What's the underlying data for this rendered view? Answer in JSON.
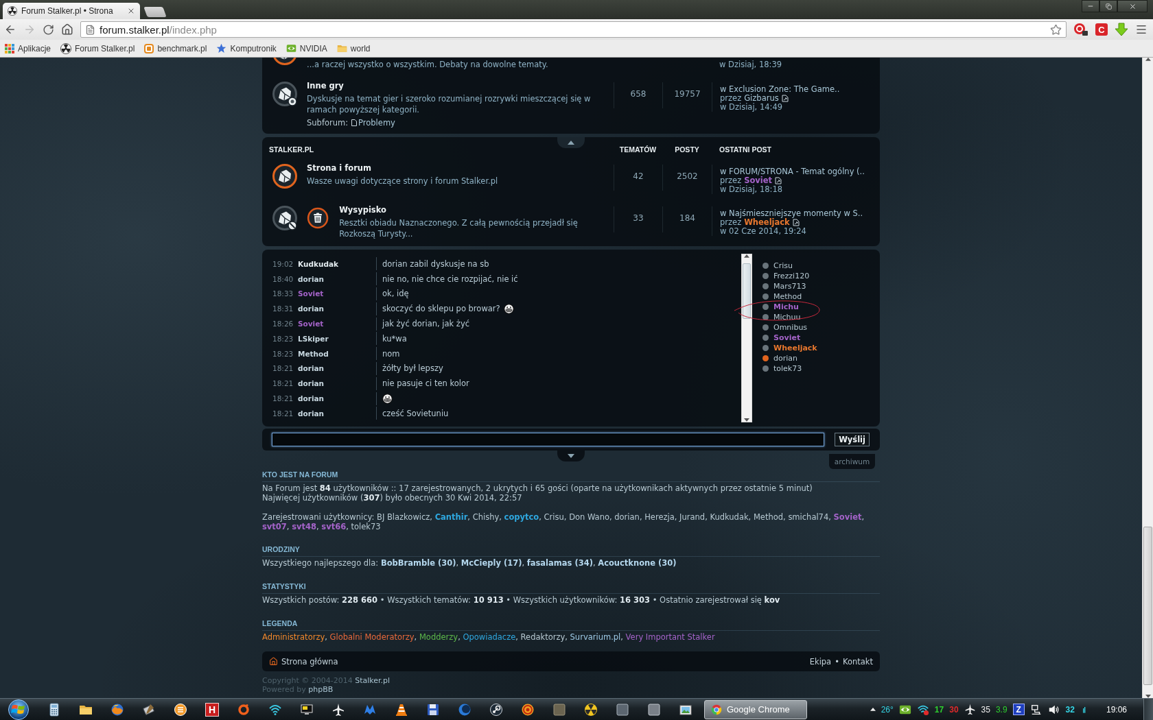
{
  "browser": {
    "tab_title": "Forum Stalker.pl • Strona",
    "url_host": "forum.stalker.pl",
    "url_path": "/index.php",
    "back_enabled": true,
    "forward_enabled": false,
    "extension_letter": "C",
    "bookmarks": [
      "Aplikacje",
      "Forum Stalker.pl",
      "benchmark.pl",
      "Komputronik",
      "NVIDIA",
      "world"
    ]
  },
  "forum_sections": [
    {
      "cut_row": {
        "unread": true,
        "description": "...a raczej wszystko o wszystkim. Debaty na dowolne tematy.",
        "last_post_time": "w Dzisiaj, 18:39"
      },
      "rows": [
        {
          "kind": "plain",
          "title": "Inne gry",
          "unread": false,
          "locked": false,
          "description": "Dyskusje na temat gier i szeroko rozumianej rozrywki mieszczącej się w ramach powyższej kategorii.",
          "subforum_label": "Subforum:",
          "subforums": [
            "Problemy"
          ],
          "topics": "658",
          "posts": "19757",
          "last_post": {
            "topic": "w Exclusion Zone: The Game..",
            "by": "przez",
            "author": {
              "name": "Gizbarus",
              "color": "#a9c8d8",
              "bold": false
            },
            "time": "w Dzisiaj, 14:49"
          }
        }
      ]
    },
    {
      "header": {
        "title": "STALKER.PL",
        "topics": "TEMATÓW",
        "posts": "POSTY",
        "last_post": "OSTATNI POST"
      },
      "rows": [
        {
          "kind": "plain",
          "title": "Strona i forum",
          "unread": true,
          "locked": false,
          "description": "Wasze uwagi dotyczące strony i forum Stalker.pl",
          "topics": "42",
          "posts": "2502",
          "last_post": {
            "topic": "w FORUM/STRONA - Temat ogólny (..",
            "by": "przez",
            "author": {
              "name": "Soviet",
              "color": "#a463c9",
              "bold": true
            },
            "time": "w Dzisiaj, 18:18"
          }
        },
        {
          "kind": "image",
          "title": "Wysypisko",
          "unread": false,
          "locked": true,
          "description": "Resztki obiadu Naznaczonego. Z całą pewnością przejadł się Rozkoszą Turysty...",
          "topics": "33",
          "posts": "184",
          "last_post": {
            "topic": "w Najśmieszniejszye momenty w S..",
            "by": "przez",
            "author": {
              "name": "Wheeljack",
              "color": "#e8772e",
              "bold": true
            },
            "time": "w 02 Cze 2014, 19:24"
          }
        }
      ]
    }
  ],
  "chat": {
    "messages": [
      {
        "time": "19:02",
        "author": "Kudkudak",
        "color": "#e4ecf0",
        "text": "dorian zabil dyskusje na sb",
        "emoticon": false
      },
      {
        "time": "18:40",
        "author": "dorian",
        "color": "#c9d9e2",
        "text": "nie no, nie chce cie rozpijać, nie ić",
        "emoticon": false
      },
      {
        "time": "18:33",
        "author": "Soviet",
        "color": "#a463c9",
        "text": "ok, idę",
        "emoticon": false
      },
      {
        "time": "18:31",
        "author": "dorian",
        "color": "#c9d9e2",
        "text": "skoczyć do sklepu po browar?",
        "emoticon": true
      },
      {
        "time": "18:26",
        "author": "Soviet",
        "color": "#a463c9",
        "text": "jak żyć dorian, jak żyć",
        "emoticon": false
      },
      {
        "time": "18:23",
        "author": "LSkiper",
        "color": "#c9d9e2",
        "text": "ku*wa",
        "emoticon": false
      },
      {
        "time": "18:23",
        "author": "Method",
        "color": "#c9d9e2",
        "text": "nom",
        "emoticon": false
      },
      {
        "time": "18:21",
        "author": "dorian",
        "color": "#c9d9e2",
        "text": "żółty był lepszy",
        "emoticon": false
      },
      {
        "time": "18:21",
        "author": "dorian",
        "color": "#c9d9e2",
        "text": "nie pasuje ci ten kolor",
        "emoticon": false
      },
      {
        "time": "18:21",
        "author": "dorian",
        "color": "#c9d9e2",
        "emoticon": true
      },
      {
        "time": "18:21",
        "author": "dorian",
        "color": "#c9d9e2",
        "text": "cześć Sovietuniu",
        "emoticon": false
      }
    ],
    "users": [
      {
        "name": "Crisu",
        "color": "#b7c9d2",
        "bold": false,
        "status_dot": {
          "color": "#69747b"
        }
      },
      {
        "name": "Frezzi120",
        "color": "#b7c9d2",
        "bold": false,
        "status_dot": {
          "color": "#69747b"
        }
      },
      {
        "name": "Mars713",
        "color": "#b7c9d2",
        "bold": false,
        "status_dot": {
          "color": "#69747b"
        }
      },
      {
        "name": "Method",
        "color": "#b7c9d2",
        "bold": false,
        "status_dot": {
          "color": "#69747b"
        }
      },
      {
        "name": "Michu",
        "color": "#a463c9",
        "bold": true,
        "status_dot": {
          "color": "#69747b"
        }
      },
      {
        "name": "Michuu",
        "color": "#b7c9d2",
        "bold": false,
        "status_dot": {
          "color": "#69747b"
        }
      },
      {
        "name": "Omnibus",
        "color": "#b7c9d2",
        "bold": false,
        "status_dot": {
          "color": "#69747b"
        }
      },
      {
        "name": "Soviet",
        "color": "#a463c9",
        "bold": true,
        "status_dot": {
          "color": "#69747b"
        }
      },
      {
        "name": "Wheeljack",
        "color": "#e8772e",
        "bold": true,
        "status_dot": {
          "color": "#69747b"
        }
      },
      {
        "name": "dorian",
        "color": "#b7c9d2",
        "bold": false,
        "status_dot": {
          "color": "#e0641e"
        }
      },
      {
        "name": "tolek73",
        "color": "#b7c9d2",
        "bold": false,
        "status_dot": {
          "color": "#69747b"
        }
      }
    ],
    "input_focused": true,
    "send_label": "Wyślij",
    "archive_label": "archiwum"
  },
  "who_is_online": {
    "heading": "KTO JEST NA FORUM",
    "summary": "Na Forum jest **84** użytkowników :: 17 zarejestrowanych, 2 ukrytych i 65 gości (oparte na użytkownikach aktywnych przez ostatnie 5 minut)",
    "record": "Najwięcej użytkowników (**307**) było obecnych 30 Kwi 2014, 22:57",
    "registered_label": "Zarejestrowani użytkownicy:",
    "separator": ",",
    "registered": [
      {
        "name": "BJ Blazkowicz",
        "color": "#b7c9d2",
        "bold": false
      },
      {
        "name": "Canthir",
        "color": "#2ea8e0",
        "bold": true
      },
      {
        "name": "Chishy",
        "color": "#b7c9d2",
        "bold": false
      },
      {
        "name": "copytco",
        "color": "#2ea8e0",
        "bold": true
      },
      {
        "name": "Crisu",
        "color": "#b7c9d2",
        "bold": false
      },
      {
        "name": "Don Wano",
        "color": "#b7c9d2",
        "bold": false
      },
      {
        "name": "dorian",
        "color": "#b7c9d2",
        "bold": false
      },
      {
        "name": "Herezja",
        "color": "#b7c9d2",
        "bold": false
      },
      {
        "name": "Jurand",
        "color": "#b7c9d2",
        "bold": false
      },
      {
        "name": "Kudkudak",
        "color": "#b7c9d2",
        "bold": false
      },
      {
        "name": "Method",
        "color": "#b7c9d2",
        "bold": false
      },
      {
        "name": "smichal74",
        "color": "#b7c9d2",
        "bold": false
      },
      {
        "name": "Soviet",
        "color": "#a463c9",
        "bold": true
      },
      {
        "name": "svt07",
        "color": "#a463c9",
        "bold": true
      },
      {
        "name": "svt48",
        "color": "#a463c9",
        "bold": true
      },
      {
        "name": "svt66",
        "color": "#a463c9",
        "bold": true
      },
      {
        "name": "tolek73",
        "color": "#b7c9d2",
        "bold": false
      }
    ]
  },
  "birthdays": {
    "heading": "URODZINY",
    "text": "Wszystkiego najlepszego dla: **BobBramble (30)**, **McCieply (17)**, **fasalamas (34)**, **Acouctknone (30)**"
  },
  "statistics": {
    "heading": "STATYSTYKI",
    "text": "Wszystkich postów: **228 660** • Wszystkich tematów: **10 913** • Wszystkich użytkowników: **16 303** • Ostatnio zarejestrował się **kov**"
  },
  "legend": {
    "heading": "LEGENDA",
    "separator": ",",
    "groups": [
      {
        "name": "Administratorzy",
        "color": "#f0862a"
      },
      {
        "name": "Globalni Moderatorzy",
        "color": "#e8683a"
      },
      {
        "name": "Modderzy",
        "color": "#5cb84a"
      },
      {
        "name": "Opowiadacze",
        "color": "#2ea8e0"
      },
      {
        "name": "Redaktorzy",
        "color": "#b7c9d2"
      },
      {
        "name": "Survarium.pl",
        "color": "#9ecae6"
      },
      {
        "name": "Very Important Stalker",
        "color": "#a463c9"
      }
    ]
  },
  "footer": {
    "home": "Strona główna",
    "links": [
      "Ekipa",
      "Kontakt"
    ],
    "link_separator": "•",
    "copyright": {
      "text": "Copyright © 2004-2014",
      "link": "Stalker.pl"
    },
    "powered": {
      "text": "Powered by",
      "link": "phpBB"
    }
  },
  "taskbar": {
    "tile_label": "H",
    "active_window": "Google Chrome",
    "tray": [
      {
        "text": "26°",
        "color": "#35d6e6"
      },
      {
        "text": "17",
        "color": "#2ed12e"
      },
      {
        "text": "30",
        "color": "#e02a2a"
      },
      {
        "text": "35",
        "color": "#f0f0f0"
      },
      {
        "text": "3.9",
        "color": "#2ed12e"
      },
      {
        "text": "32",
        "color": "#35d6e6"
      }
    ],
    "z_label": "Z",
    "clock": "19:06"
  }
}
